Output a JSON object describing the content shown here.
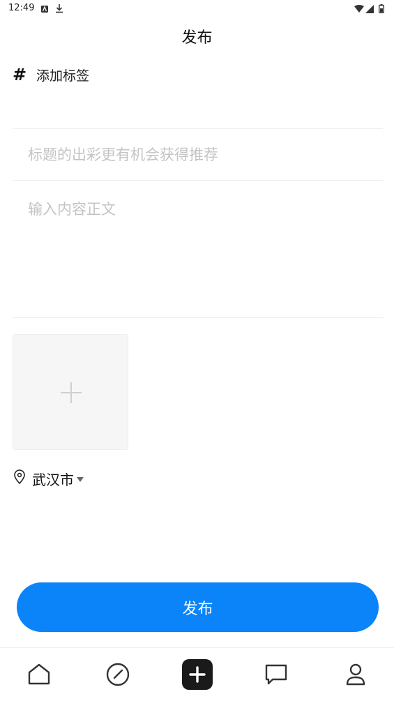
{
  "status_bar": {
    "time": "12:49",
    "icons": [
      "notification-a-icon",
      "download-icon",
      "wifi-icon",
      "signal-icon",
      "battery-icon"
    ]
  },
  "header": {
    "title": "发布"
  },
  "tags": {
    "symbol": "#",
    "label": "添加标签"
  },
  "title_field": {
    "placeholder": "标题的出彩更有机会获得推荐",
    "value": ""
  },
  "content_field": {
    "placeholder": "输入内容正文",
    "value": ""
  },
  "image_picker": {
    "icon": "plus-icon"
  },
  "location": {
    "icon": "location-pin-icon",
    "city": "武汉市",
    "dropdown_icon": "caret-down-icon"
  },
  "publish_button": {
    "label": "发布"
  },
  "bottom_nav": {
    "items": [
      {
        "name": "home",
        "icon": "home-icon"
      },
      {
        "name": "discover",
        "icon": "compass-icon"
      },
      {
        "name": "publish",
        "icon": "add-square-icon",
        "active": true
      },
      {
        "name": "messages",
        "icon": "message-icon"
      },
      {
        "name": "profile",
        "icon": "user-icon"
      }
    ]
  },
  "colors": {
    "accent": "#0a84f8",
    "placeholder": "#c4c4c4",
    "divider": "#eeeeee",
    "nav_icon": "#333333"
  }
}
